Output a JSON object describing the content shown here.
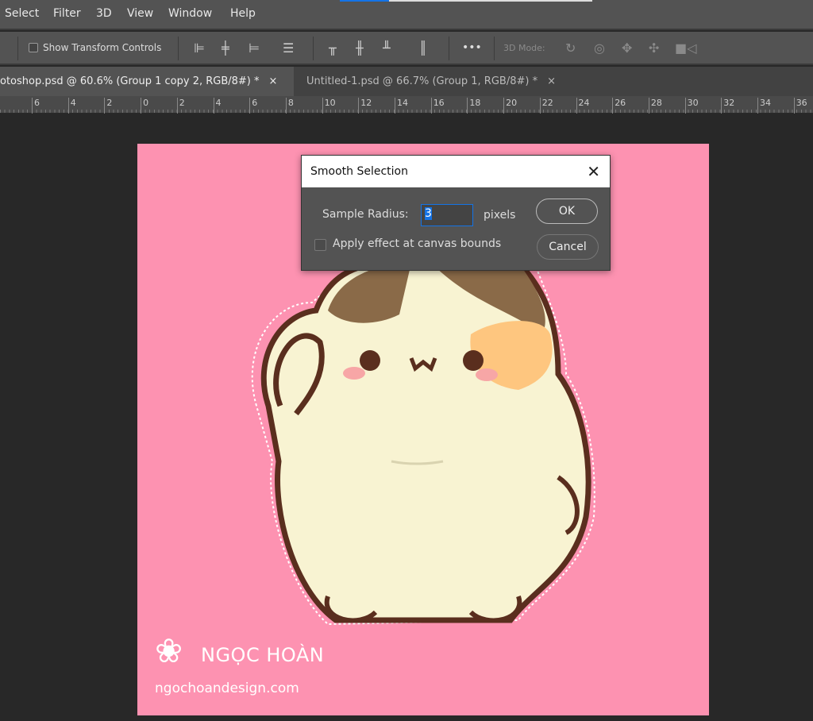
{
  "menu": [
    "Select",
    "Filter",
    "3D",
    "View",
    "Window",
    "Help"
  ],
  "toolbar": {
    "show_transform_controls": "Show Transform Controls",
    "more": "•••",
    "mode_label": "3D Mode:"
  },
  "tabs": [
    {
      "label": "otoshop.psd @ 60.6% (Group 1 copy 2, RGB/8#) *",
      "close": "×"
    },
    {
      "label": "Untitled-1.psd @ 66.7% (Group 1, RGB/8#) *",
      "close": "×"
    }
  ],
  "ruler": [
    "6",
    "4",
    "2",
    "0",
    "2",
    "4",
    "6",
    "8",
    "10",
    "12",
    "14",
    "16",
    "18",
    "20",
    "22",
    "24",
    "26",
    "28",
    "30",
    "32",
    "34",
    "36"
  ],
  "dialog": {
    "title": "Smooth Selection",
    "close": "✕",
    "sample_radius_label": "Sample Radius:",
    "sample_radius_value": "3",
    "unit": "pixels",
    "apply_bounds_label": "Apply effect at canvas bounds",
    "apply_bounds_checked": false,
    "ok": "OK",
    "cancel": "Cancel"
  },
  "watermark": {
    "brand": "NGỌC HOÀN",
    "site": "ngochoandesign.com"
  },
  "colors": {
    "canvas": "#fd92b1",
    "accent": "#1473e6",
    "ui": "#535353"
  }
}
